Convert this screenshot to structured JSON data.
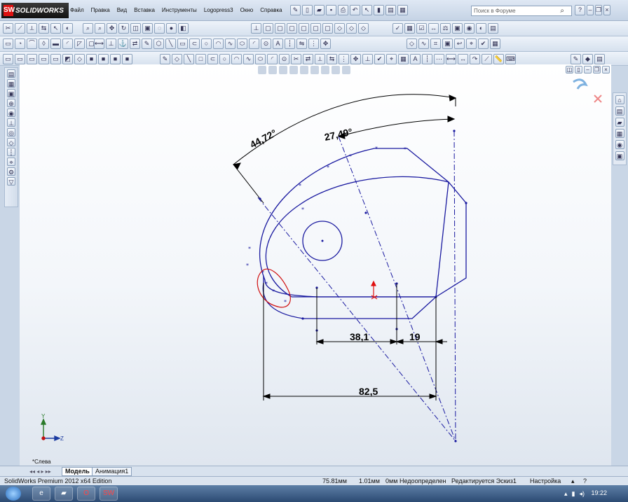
{
  "app": {
    "logo_text": "SOLIDWORKS",
    "logo_mark": "SW"
  },
  "menu": [
    "Файл",
    "Правка",
    "Вид",
    "Вставка",
    "Инструменты",
    "Logopress3",
    "Окно",
    "Справка"
  ],
  "search": {
    "placeholder": "Поиск в Форуме"
  },
  "dimensions": {
    "angle_outer": "44,72°",
    "angle_inner": "27,49°",
    "linear_a": "38,1",
    "linear_b": "19",
    "linear_total": "82,5"
  },
  "triad": {
    "y_label": "Y",
    "z_label": "Z"
  },
  "view_label": "*Слева",
  "tabs": [
    "Модель",
    "Анимация1"
  ],
  "status": {
    "edition": "SolidWorks Premium 2012 x64 Edition",
    "coord_x": "75.81мм",
    "coord_y": "1.01мм",
    "coord_z": "0мм",
    "state": "Недоопределен",
    "editing": "Редактируется Эскиз1",
    "units": "Настройка"
  },
  "taskbar": {
    "time": "19:22"
  },
  "colors": {
    "sketch": "#1a1aa0",
    "annotation_circle": "#d01010",
    "dimension": "#000000"
  }
}
